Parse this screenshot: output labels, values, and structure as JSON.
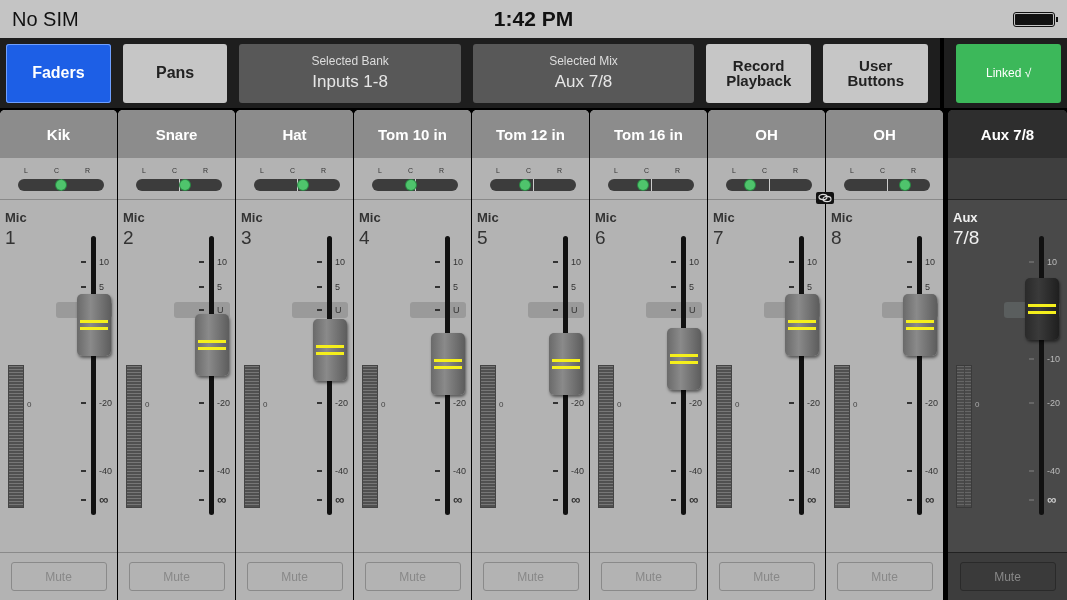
{
  "status_bar": {
    "carrier": "No SIM",
    "time": "1:42 PM"
  },
  "toolbar": {
    "tabs": [
      {
        "label": "Faders",
        "selected": true
      },
      {
        "label": "Pans",
        "selected": false
      }
    ],
    "selectors": [
      {
        "caption": "Selected Bank",
        "value": "Inputs 1-8"
      },
      {
        "caption": "Selected Mix",
        "value": "Aux 7/8"
      }
    ],
    "buttons": [
      "Record Playback",
      "User Buttons"
    ],
    "link_toggle": {
      "label": "Linked √",
      "on": true
    }
  },
  "channels": [
    {
      "kind": "input",
      "name": "Kik",
      "pan": {
        "labels": [
          "L",
          "C",
          "R"
        ],
        "level": 0.5
      },
      "source": "Mic",
      "number": "1",
      "linked": false,
      "fader": {
        "level": 0.68,
        "scale": [
          {
            "kind": "p10",
            "label": "10"
          },
          {
            "kind": "p5",
            "label": "5"
          },
          {
            "kind": "m20",
            "label": "-20"
          },
          {
            "kind": "m40",
            "label": "-40"
          },
          {
            "kind": "inf",
            "label": "∞"
          }
        ]
      },
      "meter_label": "0",
      "mute": {
        "label": "Mute",
        "on": false
      }
    },
    {
      "kind": "input",
      "name": "Snare",
      "pan": {
        "labels": [
          "L",
          "C",
          "R"
        ],
        "level": 0.57
      },
      "source": "Mic",
      "number": "2",
      "linked": false,
      "fader": {
        "level": 0.61,
        "scale": [
          {
            "kind": "p10",
            "label": "10"
          },
          {
            "kind": "p5",
            "label": "5"
          },
          {
            "kind": "unity",
            "label": "U"
          },
          {
            "kind": "m20",
            "label": "-20"
          },
          {
            "kind": "m40",
            "label": "-40"
          },
          {
            "kind": "inf",
            "label": "∞"
          }
        ]
      },
      "meter_label": "0",
      "mute": {
        "label": "Mute",
        "on": false
      }
    },
    {
      "kind": "input",
      "name": "Hat",
      "pan": {
        "labels": [
          "L",
          "C",
          "R"
        ],
        "level": 0.57
      },
      "source": "Mic",
      "number": "3",
      "linked": false,
      "fader": {
        "level": 0.59,
        "scale": [
          {
            "kind": "p10",
            "label": "10"
          },
          {
            "kind": "p5",
            "label": "5"
          },
          {
            "kind": "unity",
            "label": "U"
          },
          {
            "kind": "m20",
            "label": "-20"
          },
          {
            "kind": "m40",
            "label": "-40"
          },
          {
            "kind": "inf",
            "label": "∞"
          }
        ]
      },
      "meter_label": "0",
      "mute": {
        "label": "Mute",
        "on": false
      }
    },
    {
      "kind": "input",
      "name": "Tom 10 in",
      "pan": {
        "labels": [
          "L",
          "C",
          "R"
        ],
        "level": 0.45
      },
      "source": "Mic",
      "number": "4",
      "linked": false,
      "fader": {
        "level": 0.54,
        "scale": [
          {
            "kind": "p10",
            "label": "10"
          },
          {
            "kind": "p5",
            "label": "5"
          },
          {
            "kind": "unity",
            "label": "U"
          },
          {
            "kind": "m20",
            "label": "-20"
          },
          {
            "kind": "m40",
            "label": "-40"
          },
          {
            "kind": "inf",
            "label": "∞"
          }
        ]
      },
      "meter_label": "0",
      "mute": {
        "label": "Mute",
        "on": false
      }
    },
    {
      "kind": "input",
      "name": "Tom 12 in",
      "pan": {
        "labels": [
          "L",
          "C",
          "R"
        ],
        "level": 0.41
      },
      "source": "Mic",
      "number": "5",
      "linked": false,
      "fader": {
        "level": 0.54,
        "scale": [
          {
            "kind": "p10",
            "label": "10"
          },
          {
            "kind": "p5",
            "label": "5"
          },
          {
            "kind": "unity",
            "label": "U"
          },
          {
            "kind": "m20",
            "label": "-20"
          },
          {
            "kind": "m40",
            "label": "-40"
          },
          {
            "kind": "inf",
            "label": "∞"
          }
        ]
      },
      "meter_label": "0",
      "mute": {
        "label": "Mute",
        "on": false
      }
    },
    {
      "kind": "input",
      "name": "Tom 16 in",
      "pan": {
        "labels": [
          "L",
          "C",
          "R"
        ],
        "level": 0.41
      },
      "source": "Mic",
      "number": "6",
      "linked": false,
      "fader": {
        "level": 0.56,
        "scale": [
          {
            "kind": "p10",
            "label": "10"
          },
          {
            "kind": "p5",
            "label": "5"
          },
          {
            "kind": "unity",
            "label": "U"
          },
          {
            "kind": "m20",
            "label": "-20"
          },
          {
            "kind": "m40",
            "label": "-40"
          },
          {
            "kind": "inf",
            "label": "∞"
          }
        ]
      },
      "meter_label": "0",
      "mute": {
        "label": "Mute",
        "on": false
      }
    },
    {
      "kind": "input",
      "name": "OH",
      "pan": {
        "labels": [
          "L",
          "C",
          "R"
        ],
        "level": 0.28
      },
      "source": "Mic",
      "number": "7",
      "linked": true,
      "fader": {
        "level": 0.68,
        "scale": [
          {
            "kind": "p10",
            "label": "10"
          },
          {
            "kind": "p5",
            "label": "5"
          },
          {
            "kind": "m20",
            "label": "-20"
          },
          {
            "kind": "m40",
            "label": "-40"
          },
          {
            "kind": "inf",
            "label": "∞"
          }
        ]
      },
      "meter_label": "0",
      "mute": {
        "label": "Mute",
        "on": false
      }
    },
    {
      "kind": "input",
      "name": "OH",
      "pan": {
        "labels": [
          "L",
          "C",
          "R"
        ],
        "level": 0.71
      },
      "source": "Mic",
      "number": "8",
      "linked": false,
      "fader": {
        "level": 0.68,
        "scale": [
          {
            "kind": "p10",
            "label": "10"
          },
          {
            "kind": "p5",
            "label": "5"
          },
          {
            "kind": "m20",
            "label": "-20"
          },
          {
            "kind": "m40",
            "label": "-40"
          },
          {
            "kind": "inf",
            "label": "∞"
          }
        ]
      },
      "meter_label": "0",
      "mute": {
        "label": "Mute",
        "on": false
      }
    },
    {
      "kind": "master",
      "name": "Aux 7/8",
      "source": "Aux",
      "number": "7/8",
      "linked": false,
      "fader": {
        "level": 0.74,
        "scale": [
          {
            "kind": "p10",
            "label": "10"
          },
          {
            "kind": "m10",
            "label": "-10"
          },
          {
            "kind": "m20",
            "label": "-20"
          },
          {
            "kind": "m40",
            "label": "-40"
          },
          {
            "kind": "inf",
            "label": "∞"
          }
        ]
      },
      "meter_label": "0",
      "mute": {
        "label": "Mute",
        "on": false
      }
    }
  ]
}
